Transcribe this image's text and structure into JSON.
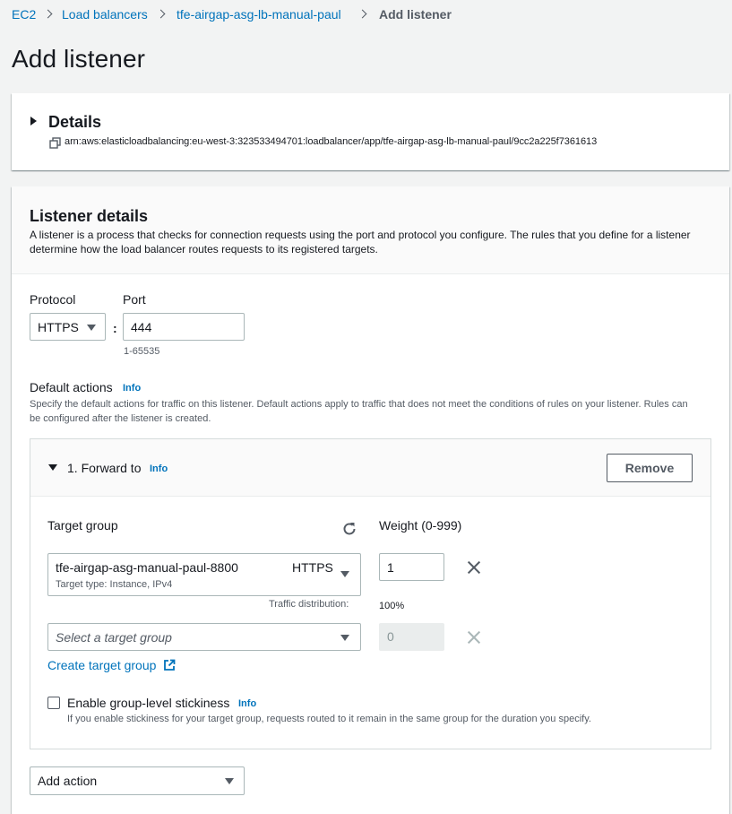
{
  "breadcrumb": {
    "items": [
      {
        "label": "EC2"
      },
      {
        "label": "Load balancers"
      },
      {
        "label": "tfe-airgap-asg-lb-manual-paul"
      }
    ],
    "current": "Add listener"
  },
  "page_title": "Add listener",
  "details": {
    "title": "Details",
    "arn": "arn:aws:elasticloadbalancing:eu-west-3:323533494701:loadbalancer/app/tfe-airgap-asg-lb-manual-paul/9cc2a225f7361613"
  },
  "listener": {
    "title": "Listener details",
    "description": "A listener is a process that checks for connection requests using the port and protocol you configure. The rules that you define for a listener determine how the load balancer routes requests to its registered targets.",
    "protocol_label": "Protocol",
    "protocol_value": "HTTPS",
    "port_label": "Port",
    "port_value": "444",
    "port_hint": "1-65535",
    "colon": ":"
  },
  "default_actions": {
    "label": "Default actions",
    "info": "Info",
    "description": "Specify the default actions for traffic on this listener. Default actions apply to traffic that does not meet the conditions of rules on your listener. Rules can be configured after the listener is created."
  },
  "forward": {
    "title": "1. Forward to",
    "info": "Info",
    "remove": "Remove",
    "target_group_label": "Target group",
    "weight_label": "Weight (0-999)",
    "row1": {
      "name": "tfe-airgap-asg-manual-paul-8800",
      "protocol": "HTTPS",
      "type": "Target type: Instance, IPv4",
      "weight": "1"
    },
    "traffic_label": "Traffic distribution:",
    "traffic_value": "100%",
    "row2": {
      "placeholder": "Select a target group",
      "weight": "0"
    },
    "create_link": "Create target group",
    "stickiness_label": "Enable group-level stickiness",
    "stickiness_info": "Info",
    "stickiness_desc": "If you enable stickiness for your target group, requests routed to it remain in the same group for the duration you specify.",
    "stickiness_checked": false
  },
  "add_action": {
    "label": "Add action"
  },
  "icons": {
    "breadcrumb_sep": "chevron-right-icon",
    "details_toggle": "caret-right-icon",
    "copy": "copy-icon",
    "refresh": "refresh-icon",
    "remove_weight": "close-icon",
    "external": "external-link-icon"
  }
}
